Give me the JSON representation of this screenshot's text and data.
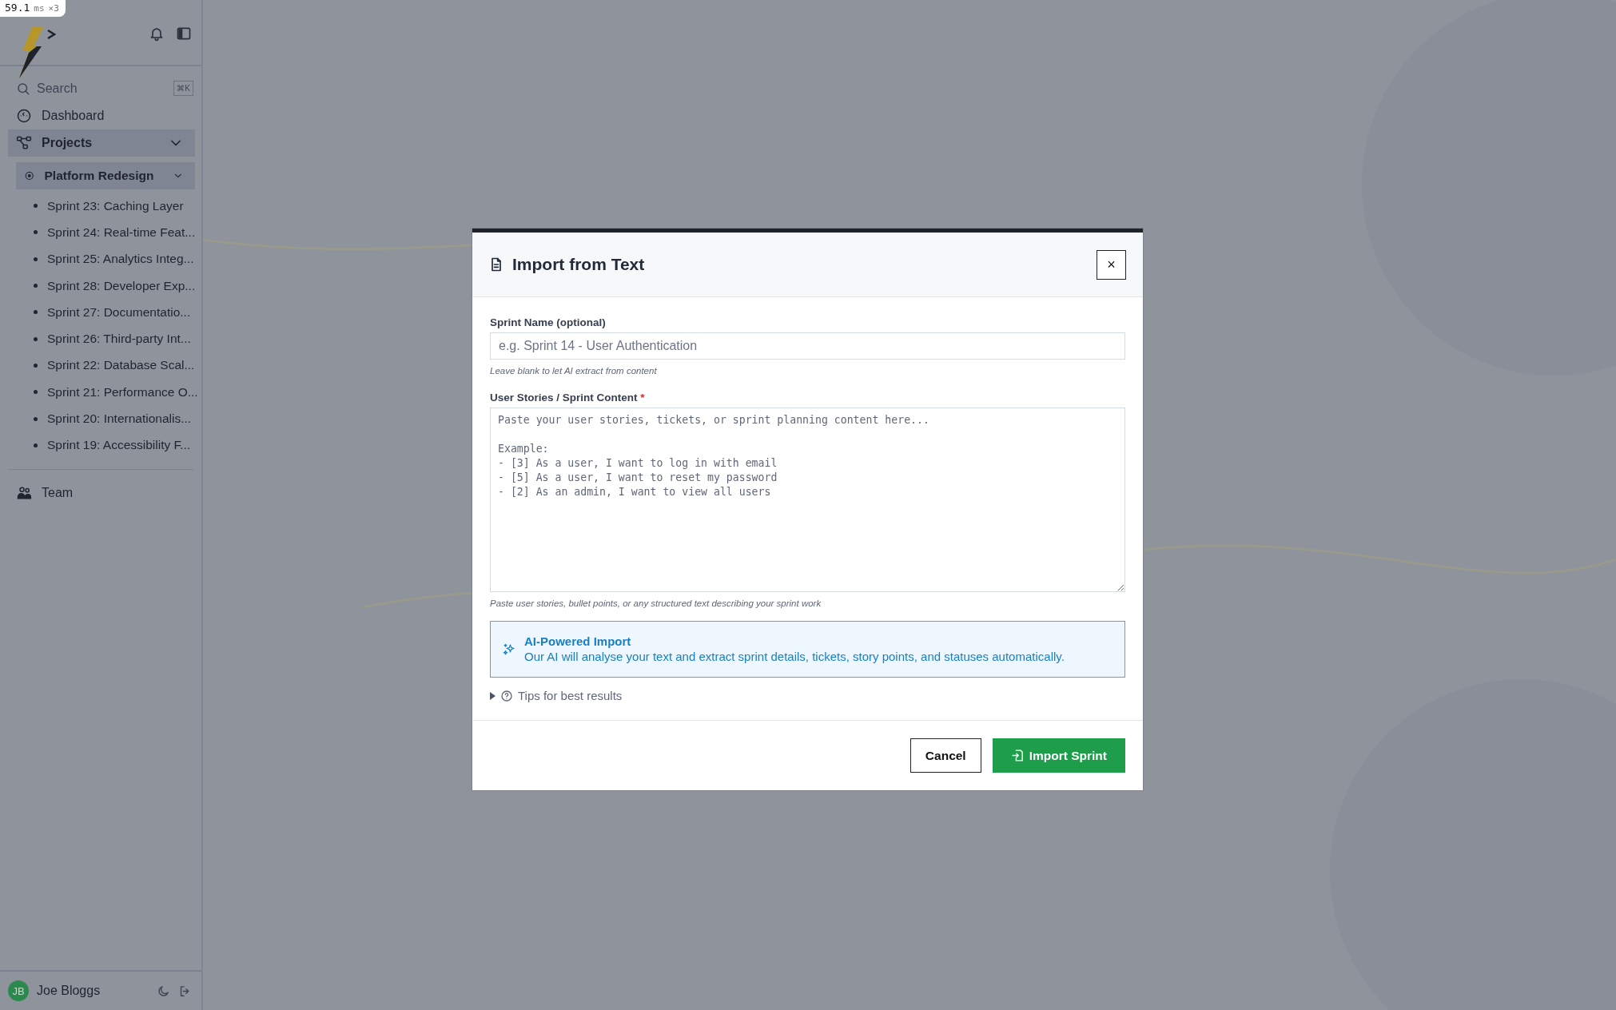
{
  "perf_badge": {
    "value": "59.1",
    "unit": "ms",
    "count": "×3"
  },
  "sidebar": {
    "search": {
      "placeholder": "Search",
      "shortcut": "⌘K"
    },
    "nav": [
      {
        "label": "Dashboard",
        "kind": "link"
      },
      {
        "label": "Projects",
        "kind": "group",
        "expanded": true,
        "children": [
          {
            "label": "Platform Redesign",
            "expanded": true,
            "children": [
              {
                "label": "Sprint 23: Caching Layer"
              },
              {
                "label": "Sprint 24: Real-time Feat..."
              },
              {
                "label": "Sprint 25: Analytics Integ..."
              },
              {
                "label": "Sprint 28: Developer Exp..."
              },
              {
                "label": "Sprint 27: Documentatio..."
              },
              {
                "label": "Sprint 26: Third-party Int..."
              },
              {
                "label": "Sprint 22: Database Scal..."
              },
              {
                "label": "Sprint 21: Performance O..."
              },
              {
                "label": "Sprint 20: Internationalis..."
              },
              {
                "label": "Sprint 19: Accessibility F..."
              }
            ]
          }
        ]
      },
      {
        "label": "Team",
        "kind": "link"
      }
    ],
    "user": {
      "initials": "JB",
      "name": "Joe Bloggs"
    }
  },
  "dialog": {
    "title": "Import from Text",
    "close": "×",
    "fields": [
      {
        "kind": "input",
        "label": "Sprint Name (optional)",
        "placeholder": "e.g. Sprint 14 - User Authentication",
        "hint": "Leave blank to let AI extract from content"
      },
      {
        "kind": "textarea",
        "label": "User Stories / Sprint Content",
        "required_mark": "*",
        "placeholder": "Paste your user stories, tickets, or sprint planning content here...\n\nExample:\n- [3] As a user, I want to log in with email\n- [5] As a user, I want to reset my password\n- [2] As an admin, I want to view all users",
        "hint": "Paste user stories, bullet points, or any structured text describing your sprint work"
      }
    ],
    "info": {
      "title": "AI-Powered Import",
      "text": "Our AI will analyse your text and extract sprint details, tickets, story points, and statuses automatically."
    },
    "tips": {
      "label": "Tips for best results",
      "expanded": false
    },
    "buttons": [
      {
        "kind": "secondary",
        "label": "Cancel"
      },
      {
        "kind": "primary",
        "label": "Import Sprint"
      }
    ]
  }
}
